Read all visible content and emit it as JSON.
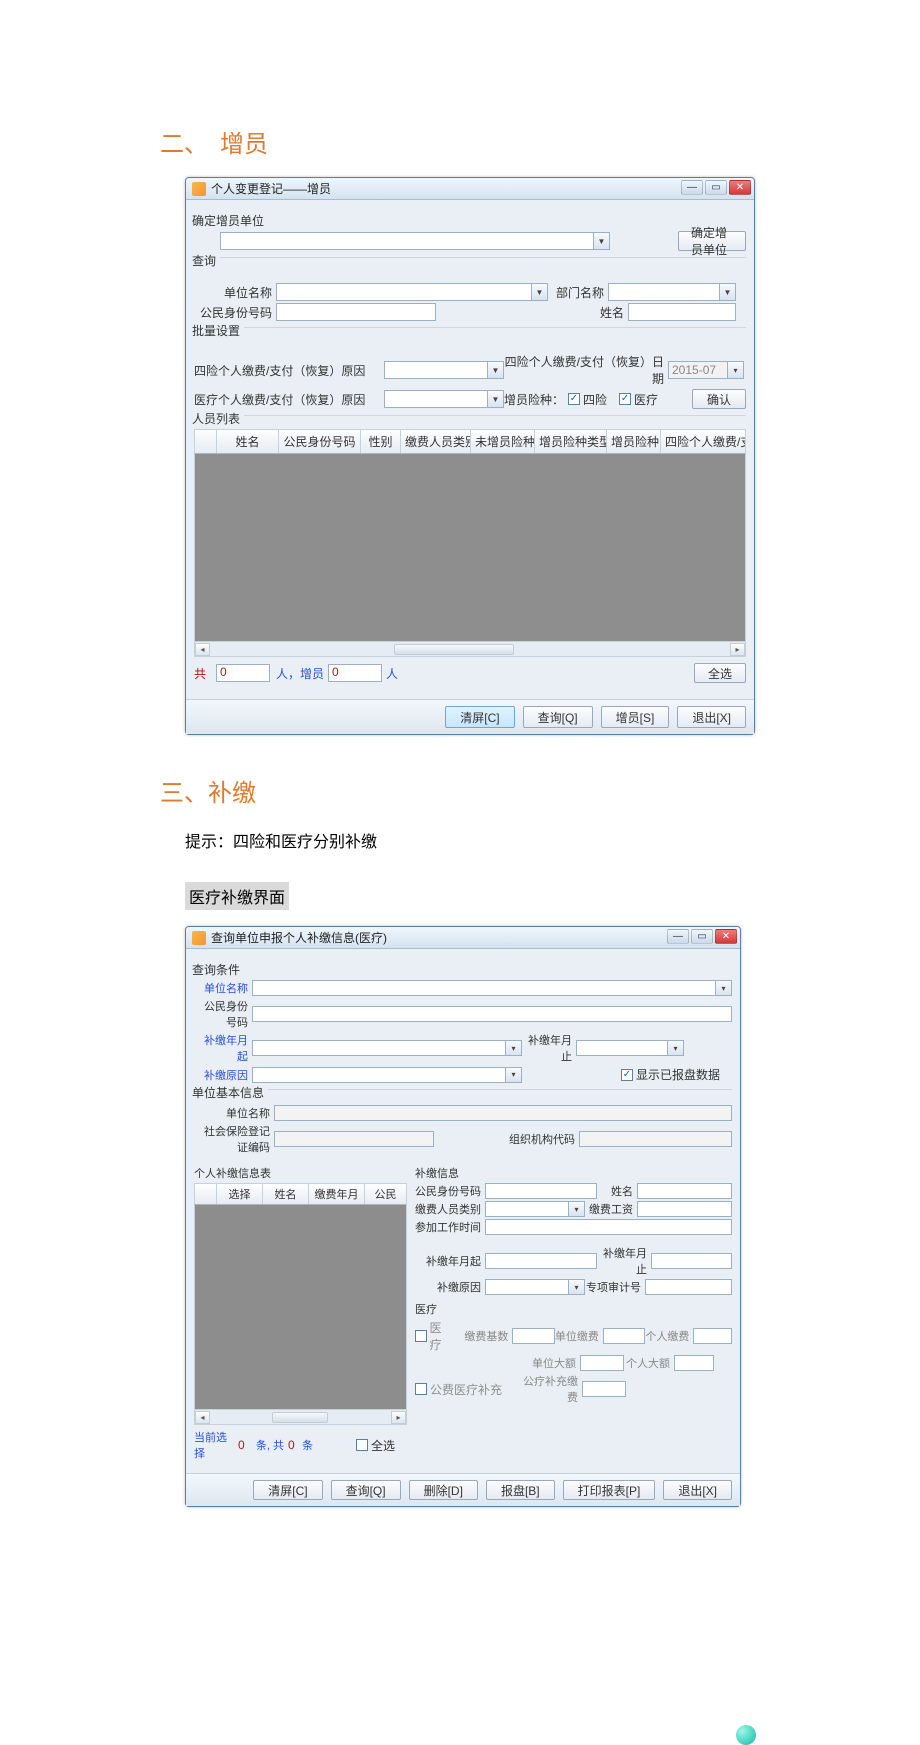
{
  "headings": {
    "h2_1": "二、　增员",
    "h2_2": "三、补缴",
    "hint": "提示：四险和医疗分别补缴",
    "sub1": "医疗补缴界面"
  },
  "win1": {
    "title": "个人变更登记——增员",
    "grp_confirm": "确定增员单位",
    "btn_confirm_unit": "确定增员单位",
    "grp_query": "查询",
    "lbl_unit": "单位名称",
    "lbl_dept": "部门名称",
    "lbl_idno": "公民身份号码",
    "lbl_name": "姓名",
    "grp_batch": "批量设置",
    "lbl_four_reason": "四险个人缴费/支付（恢复）原因",
    "lbl_med_reason": "医疗个人缴费/支付（恢复）原因",
    "lbl_four_date": "四险个人缴费/支付（恢复）日期",
    "date_val": "2015-07",
    "lbl_addtype": "增员险种：",
    "chk_four": "四险",
    "chk_med": "医疗",
    "btn_ok": "确认",
    "grp_list": "人员列表",
    "cols": [
      "",
      "姓名",
      "公民身份号码",
      "性别",
      "缴费人员类别",
      "未增员险种",
      "增员险种类型",
      "增员险种",
      "四险个人缴费/支付("
    ],
    "summary_1": "共",
    "summary_val1": "0",
    "summary_2": "人，增员",
    "summary_val2": "0",
    "summary_3": "人",
    "btn_selectall": "全选",
    "btns": [
      "清屏[C]",
      "查询[Q]",
      "增员[S]",
      "退出[X]"
    ]
  },
  "win2": {
    "title": "查询单位申报个人补缴信息(医疗)",
    "grp_q": "查询条件",
    "lbl_unit": "单位名称",
    "lbl_idno": "公民身份号码",
    "lbl_ym_from": "补缴年月起",
    "lbl_ym_to": "补缴年月止",
    "lbl_reason": "补缴原因",
    "chk_showreported": "显示已报盘数据",
    "grp_unit": "单位基本信息",
    "lbl_unitname": "单位名称",
    "lbl_socno": "社会保险登记证编码",
    "lbl_orgcode": "组织机构代码",
    "grp_left": "个人补缴信息表",
    "cols_left": [
      "",
      "选择",
      "姓名",
      "缴费年月",
      "公民"
    ],
    "grp_right": "补缴信息",
    "r_idno": "公民身份号码",
    "r_name": "姓名",
    "r_ptype": "缴费人员类别",
    "r_wage": "缴费工资",
    "r_worktime": "参加工作时间",
    "r_ym_from": "补缴年月起",
    "r_ym_to": "补缴年月止",
    "r_reason": "补缴原因",
    "r_special": "专项审计号",
    "r_medhdr": "医疗",
    "r_med_chk": "医疗",
    "r_base": "缴费基数",
    "r_unitpay": "单位缴费",
    "r_indpay": "个人缴费",
    "r_unitbig": "单位大额",
    "r_indbig": "个人大额",
    "r_pubsup_chk": "公费医疗补充",
    "r_pubsup_pay": "公疗补充缴费",
    "sel_now": "当前选择",
    "sel_v1": "0",
    "sel_mid": "条, 共",
    "sel_v2": "0",
    "sel_end": "条",
    "chk_all": "全选",
    "btns": [
      "清屏[C]",
      "查询[Q]",
      "删除[D]",
      "报盘[B]",
      "打印报表[P]",
      "退出[X]"
    ]
  }
}
